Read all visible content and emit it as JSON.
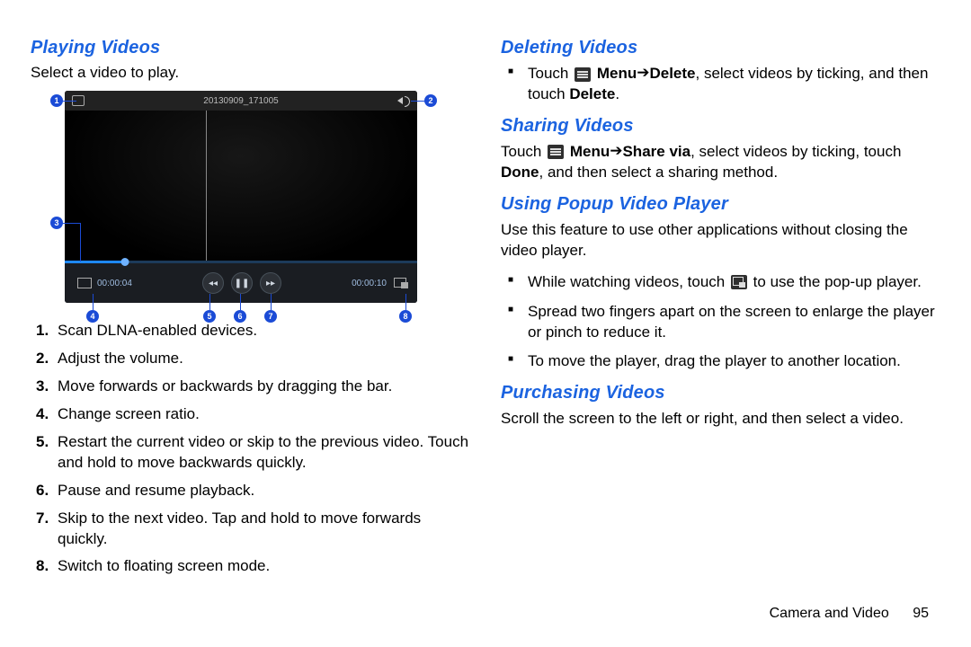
{
  "left": {
    "h1": "Playing Videos",
    "intro": "Select a video to play.",
    "player": {
      "title": "20130909_171005",
      "time_cur": "00:00:04",
      "time_tot": "00:00:10",
      "ann": [
        "1",
        "2",
        "3",
        "4",
        "5",
        "6",
        "7",
        "8"
      ]
    },
    "list": [
      "Scan DLNA-enabled devices.",
      "Adjust the volume.",
      "Move forwards or backwards by dragging the bar.",
      "Change screen ratio.",
      "Restart the current video or skip to the previous video. Touch and hold to move backwards quickly.",
      "Pause and resume playback.",
      "Skip to the next video. Tap and hold to move forwards quickly.",
      "Switch to floating screen mode."
    ]
  },
  "right": {
    "h1": "Deleting Videos",
    "del_pre": "Touch ",
    "del_menu": "Menu",
    "del_arrow": " ➔ ",
    "del_delete": "Delete",
    "del_mid": ", select videos by ticking, and then touch ",
    "del_delete2": "Delete",
    "del_end": ".",
    "h2": "Sharing Videos",
    "share_pre": "Touch ",
    "share_menu": "Menu",
    "share_arrow": " ➔ ",
    "share_via": "Share via",
    "share_mid": ", select videos by ticking, touch ",
    "share_done": "Done",
    "share_end": ", and then select a sharing method.",
    "h3": "Using Popup Video Player",
    "pop_intro": "Use this feature to use other applications without closing the video player.",
    "pop_b1a": "While watching videos, touch ",
    "pop_b1b": " to use the pop-up player.",
    "pop_b2": "Spread two fingers apart on the screen to enlarge the player or pinch to reduce it.",
    "pop_b3": "To move the player, drag the player to another location.",
    "h4": "Purchasing Videos",
    "purch": "Scroll the screen to the left or right, and then select a video."
  },
  "footer": {
    "section": "Camera and Video",
    "page": "95"
  }
}
